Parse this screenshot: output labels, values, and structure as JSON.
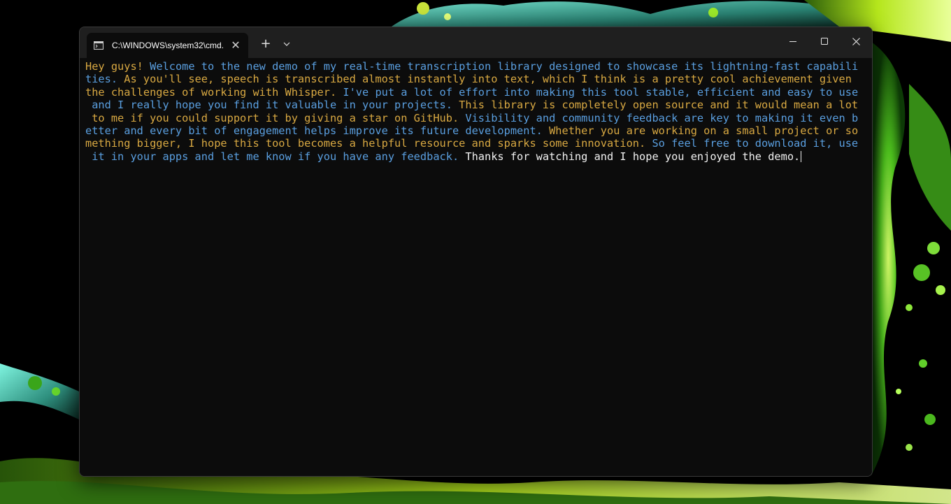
{
  "window": {
    "tab_title": "C:\\WINDOWS\\system32\\cmd.",
    "tab_icon": "terminal-icon",
    "close_tab_symbol": "✕",
    "new_tab_symbol": "+",
    "dropdown_icon": "chevron-down-icon",
    "caption_buttons": [
      "minimize-icon",
      "maximize-icon",
      "close-icon"
    ]
  },
  "colors": {
    "segment_yellow": "#d9a942",
    "segment_blue": "#5a9fe0",
    "segment_white": "#f2f2f2",
    "terminal_background": "#0c0c0c"
  },
  "terminal": {
    "lines": [
      [
        {
          "text": "Hey guys! ",
          "color": "yellow"
        },
        {
          "text": "Welcome to the new demo of my real-time transcription library designed to showcase its lightning-fast capabili",
          "color": "blue"
        }
      ],
      [
        {
          "text": "ties. ",
          "color": "blue"
        },
        {
          "text": "As you'll see, speech is transcribed almost instantly into text, which I think is a pretty cool achievement given",
          "color": "yellow"
        }
      ],
      [
        {
          "text": "the challenges of working with Whisper. ",
          "color": "yellow"
        },
        {
          "text": "I've put a lot of effort into making this tool stable, efficient and easy to use",
          "color": "blue"
        }
      ],
      [
        {
          "text": " and I really hope you find it valuable in your projects. ",
          "color": "blue"
        },
        {
          "text": "This library is completely open source and it would mean a lot",
          "color": "yellow"
        }
      ],
      [
        {
          "text": " to me if you could support it by giving a star on GitHub. ",
          "color": "yellow"
        },
        {
          "text": "Visibility and community feedback are key to making it even b",
          "color": "blue"
        }
      ],
      [
        {
          "text": "etter and every bit of engagement helps improve its future development. ",
          "color": "blue"
        },
        {
          "text": "Whether you are working on a small project or so",
          "color": "yellow"
        }
      ],
      [
        {
          "text": "mething bigger, I hope this tool becomes a helpful resource and sparks some innovation. ",
          "color": "yellow"
        },
        {
          "text": "So feel free to download it, use",
          "color": "blue"
        }
      ],
      [
        {
          "text": " it in your apps and let me know if you have any feedback. ",
          "color": "blue"
        },
        {
          "text": "Thanks for watching and I hope you enjoyed the demo.",
          "color": "white"
        }
      ]
    ]
  }
}
